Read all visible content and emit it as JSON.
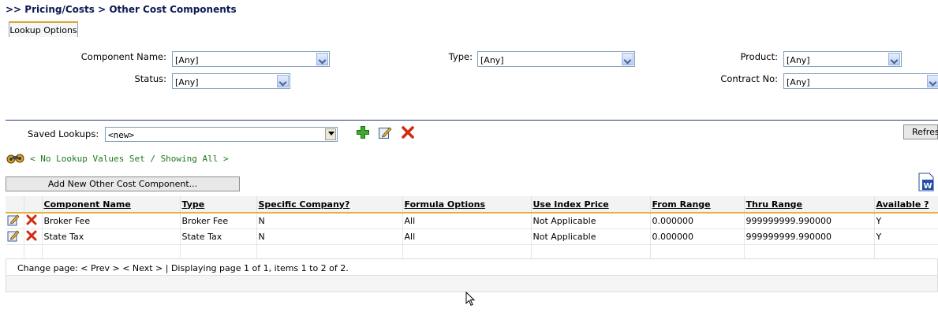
{
  "breadcrumb": ">> Pricing/Costs > Other Cost Components",
  "tabs": {
    "lookup_options": "Lookup Options"
  },
  "filters": {
    "component_name": {
      "label": "Component Name:",
      "value": "[Any]"
    },
    "type": {
      "label": "Type:",
      "value": "[Any]"
    },
    "product": {
      "label": "Product:",
      "value": "[Any]"
    },
    "status": {
      "label": "Status:",
      "value": "[Any]"
    },
    "contract_no": {
      "label": "Contract No:",
      "value": "[Any]"
    }
  },
  "saved_lookups": {
    "label": "Saved Lookups:",
    "value": "<new>"
  },
  "refresh_label": "Refresh",
  "lookup_info": "< No Lookup Values Set / Showing All >",
  "add_button": "Add New Other Cost Component...",
  "table": {
    "columns": [
      "Component Name",
      "Type",
      "Specific Company?",
      "Formula Options",
      "Use Index Price",
      "From Range",
      "Thru Range",
      "Available ?"
    ],
    "rows": [
      [
        "Broker Fee",
        "Broker Fee",
        "N",
        "All",
        "Not Applicable",
        "0.000000",
        "999999999.990000",
        "Y"
      ],
      [
        "State Tax",
        "State Tax",
        "N",
        "All",
        "Not Applicable",
        "0.000000",
        "999999999.990000",
        "Y"
      ]
    ]
  },
  "pager": "Change page: < Prev > < Next >  |  Displaying page 1 of 1, items 1 to 2 of 2.",
  "icons": {
    "add": "plus-icon",
    "edit": "edit-pencil-icon",
    "delete": "red-x-icon",
    "binoculars": "binoculars-icon",
    "export": "word-export-icon"
  },
  "colors": {
    "accent": "#e6b13a",
    "info_text": "#1a7a1a",
    "divider": "#2a3a7a",
    "breadcrumb": "#0b1a52"
  }
}
